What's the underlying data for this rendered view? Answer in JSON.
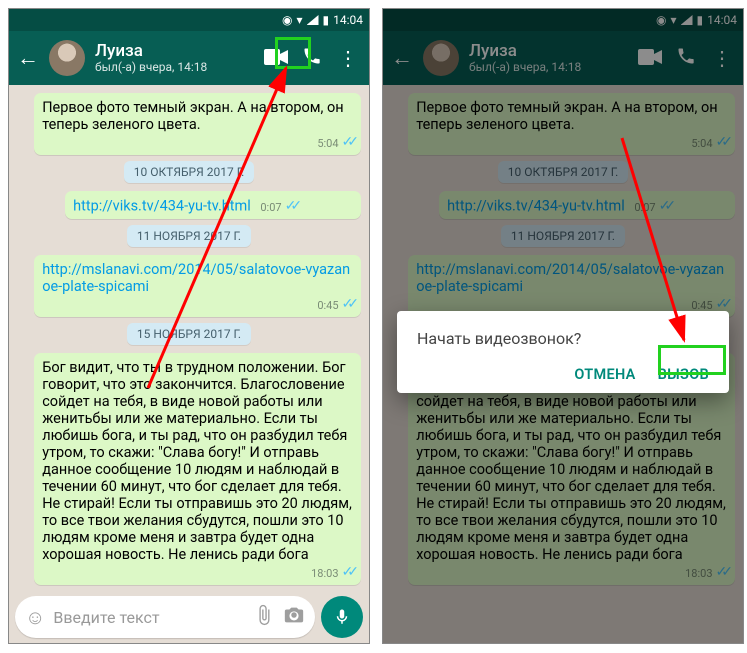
{
  "status": {
    "time": "14:04",
    "battery_icon": "▮",
    "signal_icon": "▲"
  },
  "appbar": {
    "name": "Луиза",
    "subtitle": "был(-а) вчера, 14:18"
  },
  "icons": {
    "back": "←",
    "video": "■",
    "phone": "📞",
    "menu": "⋮",
    "emoji": "☺",
    "attach": "📎",
    "camera": "◉",
    "mic": "🎤"
  },
  "chat": {
    "msg1": {
      "text": "Первое фото темный экран. А на втором, он теперь зеленого цвета.",
      "time": "5:04"
    },
    "date1": "10 ОКТЯБРЯ 2017 Г.",
    "link1": {
      "href": "http://viks.tv/434-yu-tv.html",
      "time": "0:07"
    },
    "date2": "11 НОЯБРЯ 2017 Г.",
    "link2": {
      "href": "http://mslanavi.com/2014/05/salatovoe-vyazanoe-plate-spicami",
      "time": "0:45"
    },
    "date3": "15 НОЯБРЯ 2017 Г.",
    "msg2": {
      "text": "Бог видит, что ты в трудном положении. Бог говорит,  что это закончится. Благословение сойдет на тебя, в виде новой работы или женитьбы или же материально. Если ты любишь бога, и ты рад, что он разбудил тебя утром, то скажи: \"Слава богу!\"  И отправь данное сообщение 10 людям и наблюдай в течении 60 минут, что бог сделает для тебя. Не стирай! Если ты отправишь это 20 людям, то все твои желания сбудутся, пошли это 10 людям кроме меня и завтра будет одна хорошая новость. Не ленись ради бога",
      "time": "18:03"
    }
  },
  "input": {
    "placeholder": "Введите текст"
  },
  "dialog": {
    "title": "Начать видеозвонок?",
    "cancel": "ОТМЕНА",
    "call": "ВЫЗОВ"
  }
}
